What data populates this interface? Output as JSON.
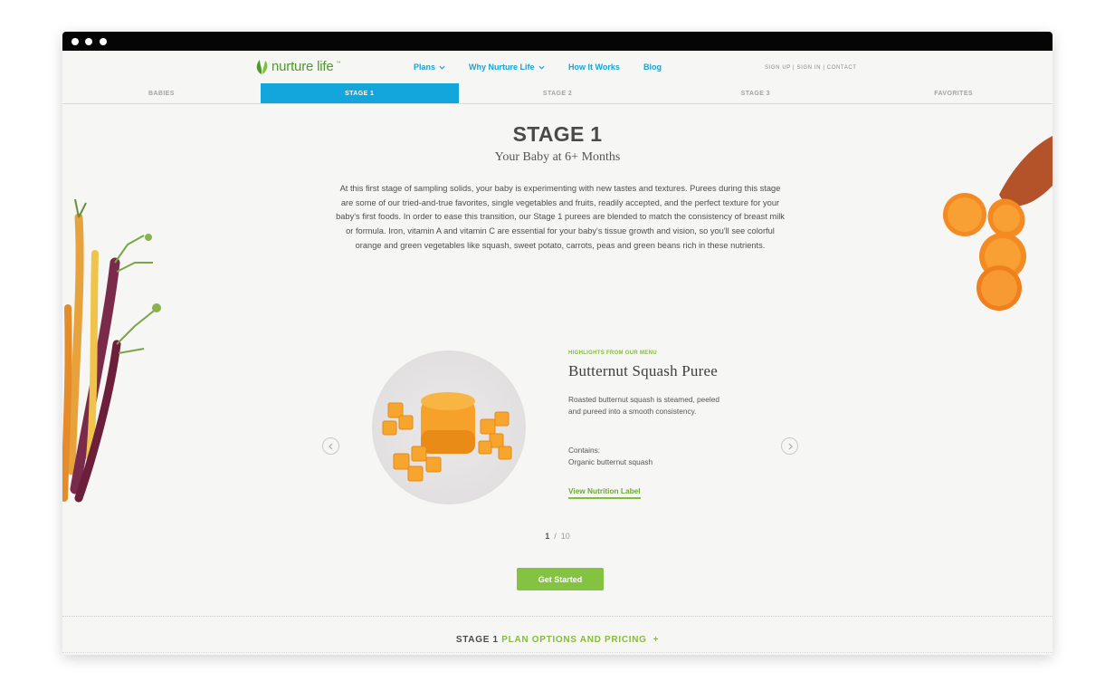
{
  "brand": {
    "name": "nurture life",
    "tm": "™",
    "green": "#4c9a2a",
    "accent_blue": "#12a6dc",
    "accent_green": "#84c241"
  },
  "nav": {
    "links": [
      {
        "label": "Plans",
        "has_dropdown": true
      },
      {
        "label": "Why Nurture Life",
        "has_dropdown": true
      },
      {
        "label": "How It Works",
        "has_dropdown": false
      },
      {
        "label": "Blog",
        "has_dropdown": false
      }
    ],
    "utility": {
      "sign_up": "SIGN UP",
      "sign_in": "SIGN IN",
      "contact": "CONTACT",
      "separator": "|"
    }
  },
  "tabs": [
    {
      "label": "BABIES",
      "active": false
    },
    {
      "label": "STAGE 1",
      "active": true
    },
    {
      "label": "STAGE 2",
      "active": false
    },
    {
      "label": "STAGE 3",
      "active": false
    },
    {
      "label": "FAVORITES",
      "active": false
    }
  ],
  "hero": {
    "title": "STAGE 1",
    "subtitle": "Your Baby at 6+ Months",
    "intro": "At this first stage of sampling solids, your baby is experimenting with new tastes and textures. Purees during this stage are some of our tried-and-true favorites, single vegetables and fruits, readily accepted, and the perfect texture for your baby's first foods. In order to ease this transition, our Stage 1 purees are blended to match the consistency of breast milk or formula. Iron, vitamin A and vitamin C are essential for your baby's tissue growth and vision, so you'll see colorful orange and green vegetables like squash, sweet potato, carrots, peas and green beans rich in these nutrients."
  },
  "carousel": {
    "eyebrow": "HIGHLIGHTS FROM OUR MENU",
    "item_title": "Butternut Squash Puree",
    "description": "Roasted butternut squash is steamed, peeled and pureed into a smooth consistency.",
    "contains_label": "Contains:",
    "contains_value": "Organic butternut squash",
    "nutrition_link": "View Nutrition Label",
    "current": "1",
    "separator": "/",
    "total": "10",
    "prev_icon": "chevron-left-icon",
    "next_icon": "chevron-right-icon"
  },
  "cta": {
    "label": "Get Started"
  },
  "pricing": {
    "stage": "STAGE 1",
    "label": "PLAN OPTIONS AND PRICING",
    "plus": "+"
  }
}
